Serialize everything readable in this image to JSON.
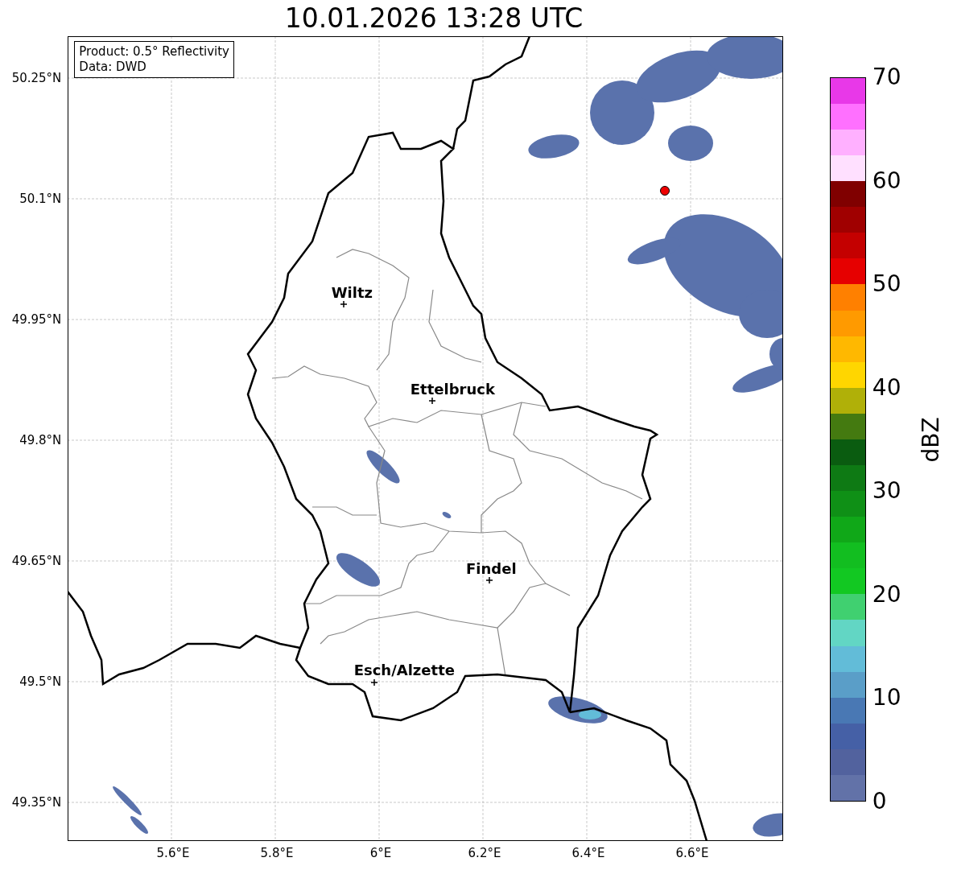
{
  "title": "10.01.2026 13:28 UTC",
  "info_box": {
    "lines": [
      "Product: 0.5° Reflectivity",
      "Data: DWD"
    ]
  },
  "y_ticks": [
    "50.25°N",
    "50.1°N",
    "49.95°N",
    "49.8°N",
    "49.65°N",
    "49.5°N",
    "49.35°N"
  ],
  "x_ticks": [
    "5.6°E",
    "5.8°E",
    "6°E",
    "6.2°E",
    "6.4°E",
    "6.6°E"
  ],
  "cities": [
    {
      "name": "Wiltz"
    },
    {
      "name": "Ettelbruck"
    },
    {
      "name": "Findel"
    },
    {
      "name": "Esch/Alzette"
    }
  ],
  "colorbar": {
    "label": "dBZ",
    "ticks": [
      "70",
      "60",
      "50",
      "40",
      "30",
      "20",
      "10",
      "0"
    ],
    "bands": [
      {
        "color": "#6272a8"
      },
      {
        "color": "#52629e"
      },
      {
        "color": "#4560a6"
      },
      {
        "color": "#4978b4"
      },
      {
        "color": "#5a9ec8"
      },
      {
        "color": "#62bcd8"
      },
      {
        "color": "#62d6c4"
      },
      {
        "color": "#40d070"
      },
      {
        "color": "#12c822"
      },
      {
        "color": "#12be20"
      },
      {
        "color": "#10a818"
      },
      {
        "color": "#0f9016"
      },
      {
        "color": "#0e7a14"
      },
      {
        "color": "#0a5c10"
      },
      {
        "color": "#447a10"
      },
      {
        "color": "#b0b008"
      },
      {
        "color": "#ffd600"
      },
      {
        "color": "#ffb800"
      },
      {
        "color": "#ff9a00"
      },
      {
        "color": "#ff8000"
      },
      {
        "color": "#e60000"
      },
      {
        "color": "#c40000"
      },
      {
        "color": "#a00000"
      },
      {
        "color": "#800000"
      },
      {
        "color": "#ffe0ff"
      },
      {
        "color": "#ffb0ff"
      },
      {
        "color": "#ff70ff"
      },
      {
        "color": "#e838e8"
      }
    ]
  }
}
